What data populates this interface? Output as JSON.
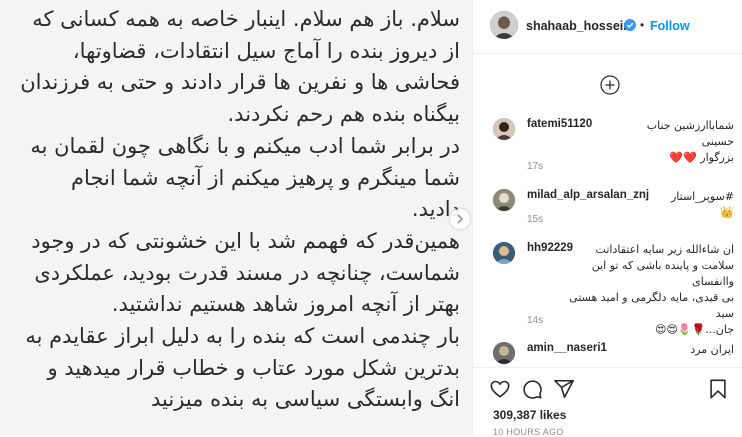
{
  "post": {
    "text_lines": [
      "سلام. باز هم سلام. اینبار خاصه به همه کسانی که",
      "از دیروز بنده را آماج سیل انتقادات، قضاوتها،",
      "فحاشی ها و نفرین ها قرار دادند و حتی به فرزندان",
      "بیگناه بنده هم رحم نکردند.",
      "در برابر شما ادب میکنم و با نگاهی چون لقمان  به",
      "شما مینگرم و پرهیز میکنم از آنچه شما انجام",
      "دادید.",
      "همین‌قدر که فهمم شد با این خشونتی که در وجود",
      "شماست، چنانچه در مسند قدرت بودید، عملکردی",
      "بهتر از آنچه امروز شاهد هستیم نداشتید.",
      "بار چندمی است که بنده را به دلیل ابراز عقایدم به",
      "بدترین شکل مورد عتاب و خطاب قرار میدهید و",
      "انگ وابستگی سیاسی به بنده میزنید"
    ]
  },
  "header": {
    "username": "shahaab_hosseini",
    "separator": "•",
    "follow_label": "Follow"
  },
  "comments": [
    {
      "username": "fatemi51120",
      "text_lines": [
        "شمابا‌ارزشین جناب حسینی",
        "بزرگوار ❤️❤️"
      ],
      "time": "17s"
    },
    {
      "username": "milad_alp_arsalan_znj",
      "text_lines": [
        "#سوپر_استار👑"
      ],
      "time": "15s"
    },
    {
      "username": "hh92229",
      "text_lines": [
        "ان شاءالله زیر سایه اعتقاداتت",
        "سلامت و پاینده باشی که تو این واانفسای",
        "بی قیدی، مایه دلگرمی و امید هستی سید",
        "جان...🌹🌷😍😍"
      ],
      "time": "14s"
    },
    {
      "username": "amin__naseri1",
      "text_lines": [
        "ایران مرد"
      ],
      "time": ""
    }
  ],
  "actions": {
    "likes": "309,387 likes",
    "time": "10 HOURS AGO"
  },
  "colors": {
    "follow": "#0095f6",
    "verified": "#3897f0",
    "muted": "#8e8e8e"
  }
}
